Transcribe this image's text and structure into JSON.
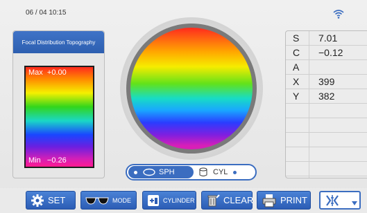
{
  "status": {
    "datetime": "06 / 04  10:15",
    "wifi_icon": "wifi-icon"
  },
  "left_panel": {
    "title": "Focal Distribution Topography",
    "legend_max_label": "Max",
    "legend_max_value": "+0.00",
    "legend_min_label": "Min",
    "legend_min_value": "−0.26"
  },
  "toggle": {
    "sph_label": "SPH",
    "cyl_label": "CYL",
    "selected": "SPH"
  },
  "measurements": {
    "rows": [
      {
        "label": "S",
        "value": "7.01"
      },
      {
        "label": "C",
        "value": "−0.12"
      },
      {
        "label": "A",
        "value": ""
      },
      {
        "label": "X",
        "value": "399"
      },
      {
        "label": "Y",
        "value": "382"
      },
      {
        "label": "",
        "value": ""
      },
      {
        "label": "",
        "value": ""
      },
      {
        "label": "",
        "value": ""
      },
      {
        "label": "",
        "value": ""
      },
      {
        "label": "",
        "value": ""
      }
    ]
  },
  "toolbar": {
    "set_label": "SET",
    "mode_label": "MODE",
    "cylinder_label": "CYLINDER",
    "clear_label": "CLEAR",
    "print_label": "PRINT",
    "accent": "#3b6dc0"
  }
}
